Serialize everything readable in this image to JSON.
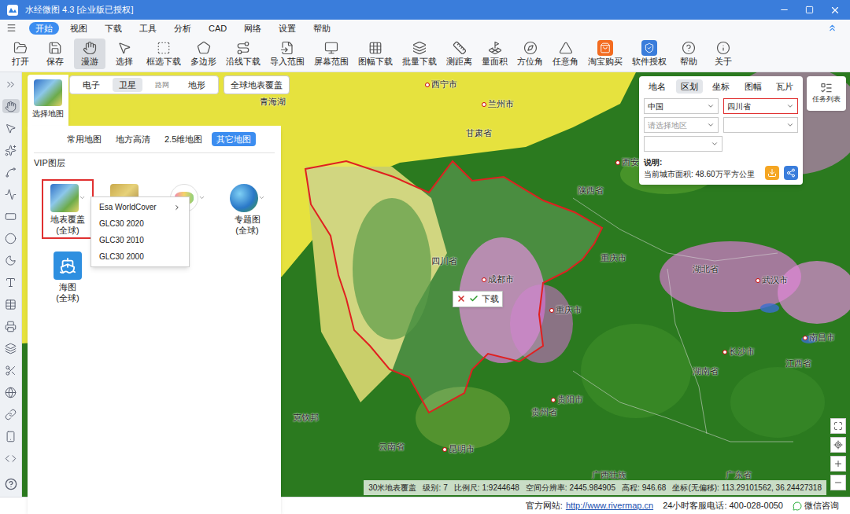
{
  "window": {
    "title": "水经微图 4.3 [企业版已授权]"
  },
  "menu": [
    {
      "label": "开始",
      "selected": true
    },
    {
      "label": "视图",
      "selected": false
    },
    {
      "label": "下载",
      "selected": false
    },
    {
      "label": "工具",
      "selected": false
    },
    {
      "label": "分析",
      "selected": false
    },
    {
      "label": "CAD",
      "selected": false
    },
    {
      "label": "网络",
      "selected": false
    },
    {
      "label": "设置",
      "selected": false
    },
    {
      "label": "帮助",
      "selected": false
    }
  ],
  "toolbar": [
    {
      "label": "打开",
      "selected": false
    },
    {
      "label": "保存",
      "selected": false
    },
    {
      "label": "漫游",
      "selected": true
    },
    {
      "label": "选择",
      "selected": false
    },
    {
      "label": "框选下载",
      "selected": false
    },
    {
      "label": "多边形",
      "selected": false
    },
    {
      "label": "沿线下载",
      "selected": false
    },
    {
      "label": "导入范围",
      "selected": false
    },
    {
      "label": "屏幕范围",
      "selected": false
    },
    {
      "label": "图幅下载",
      "selected": false
    },
    {
      "label": "批量下载",
      "selected": false
    },
    {
      "label": "测距离",
      "selected": false
    },
    {
      "label": "量面积",
      "selected": false
    },
    {
      "label": "方位角",
      "selected": false
    },
    {
      "label": "任意角",
      "selected": false
    },
    {
      "label": "淘宝购买",
      "selected": false
    },
    {
      "label": "软件授权",
      "selected": false
    },
    {
      "label": "帮助",
      "selected": false
    },
    {
      "label": "关于",
      "selected": false
    }
  ],
  "map_picker": {
    "caption": "选择地图",
    "sources": [
      {
        "label": "电子",
        "selected": false,
        "disabled": false
      },
      {
        "label": "卫星",
        "selected": true,
        "disabled": false
      },
      {
        "label": "路网",
        "selected": false,
        "disabled": true
      },
      {
        "label": "地形",
        "selected": false,
        "disabled": false
      }
    ],
    "global_button": "全球地表覆盖",
    "categories": [
      {
        "label": "常用地图",
        "selected": false
      },
      {
        "label": "地方高清",
        "selected": false
      },
      {
        "label": "2.5维地图",
        "selected": false
      },
      {
        "label": "其它地图",
        "selected": true
      }
    ],
    "section": "VIP图层",
    "layers": [
      {
        "label": "地表覆盖",
        "sub": "(全球)",
        "kind": "landcover",
        "selected": true,
        "has_menu": true
      },
      {
        "kind": "terrain",
        "selected": false,
        "has_menu": true
      },
      {
        "kind": "admin",
        "selected": false,
        "has_menu": true
      },
      {
        "label": "专题图",
        "sub": "(全球)",
        "kind": "thematic",
        "selected": false,
        "has_menu": true
      },
      {
        "label": "海图",
        "sub": "(全球)",
        "kind": "chart",
        "selected": false,
        "has_menu": false
      }
    ],
    "menu": [
      {
        "label": "Esa WorldCover",
        "submenu": true
      },
      {
        "label": "GLC30 2020",
        "submenu": false
      },
      {
        "label": "GLC30 2010",
        "submenu": false
      },
      {
        "label": "GLC30 2000",
        "submenu": false
      }
    ]
  },
  "region_panel": {
    "tabs": [
      {
        "label": "地名",
        "selected": false
      },
      {
        "label": "区划",
        "selected": true
      },
      {
        "label": "坐标",
        "selected": false
      },
      {
        "label": "图幅",
        "selected": false
      },
      {
        "label": "瓦片",
        "selected": false
      }
    ],
    "country": "中国",
    "province": "四川省",
    "district_placeholder": "请选择地区",
    "note_title": "说明:",
    "note": "当前城市面积: 48.60万平方公里"
  },
  "task_list": "任务列表",
  "map": {
    "labels": [
      {
        "text": "青海湖",
        "kind": "place"
      },
      {
        "text": "西宁市",
        "kind": "city"
      },
      {
        "text": "兰州市",
        "kind": "city"
      },
      {
        "text": "甘肃省",
        "kind": "province"
      },
      {
        "text": "西安市",
        "kind": "city"
      },
      {
        "text": "陕西省",
        "kind": "province"
      },
      {
        "text": "四川省",
        "kind": "province"
      },
      {
        "text": "成都市",
        "kind": "city"
      },
      {
        "text": "重庆市",
        "kind": "province"
      },
      {
        "text": "重庆市",
        "kind": "city"
      },
      {
        "text": "湖北省",
        "kind": "province"
      },
      {
        "text": "武汉市",
        "kind": "city"
      },
      {
        "text": "长沙市",
        "kind": "city"
      },
      {
        "text": "湖南省",
        "kind": "province"
      },
      {
        "text": "南昌市",
        "kind": "city"
      },
      {
        "text": "江西省",
        "kind": "province"
      },
      {
        "text": "贵阳市",
        "kind": "city"
      },
      {
        "text": "贵州省",
        "kind": "province"
      },
      {
        "text": "昆明市",
        "kind": "city"
      },
      {
        "text": "云南省",
        "kind": "province"
      },
      {
        "text": "克钦邦",
        "kind": "province"
      },
      {
        "text": "广西壮族",
        "kind": "province"
      },
      {
        "text": "广东省",
        "kind": "province"
      }
    ],
    "popup": "下载"
  },
  "status": [
    {
      "label": "30米地表覆盖"
    },
    {
      "label": "级别:",
      "value": "7"
    },
    {
      "label": "比例尺:",
      "value": "1:9244648"
    },
    {
      "label": "空间分辨率:",
      "value": "2445.984905"
    },
    {
      "label": "高程:",
      "value": "946.68"
    },
    {
      "label": "坐标(无偏移):",
      "value": "113.29101562, 36.24427318"
    }
  ],
  "footer": {
    "site_label": "官方网站:",
    "site_url": "http://www.rivermap.cn",
    "phone": "24小时客服电话: 400-028-0050",
    "wechat": "微信咨询"
  }
}
